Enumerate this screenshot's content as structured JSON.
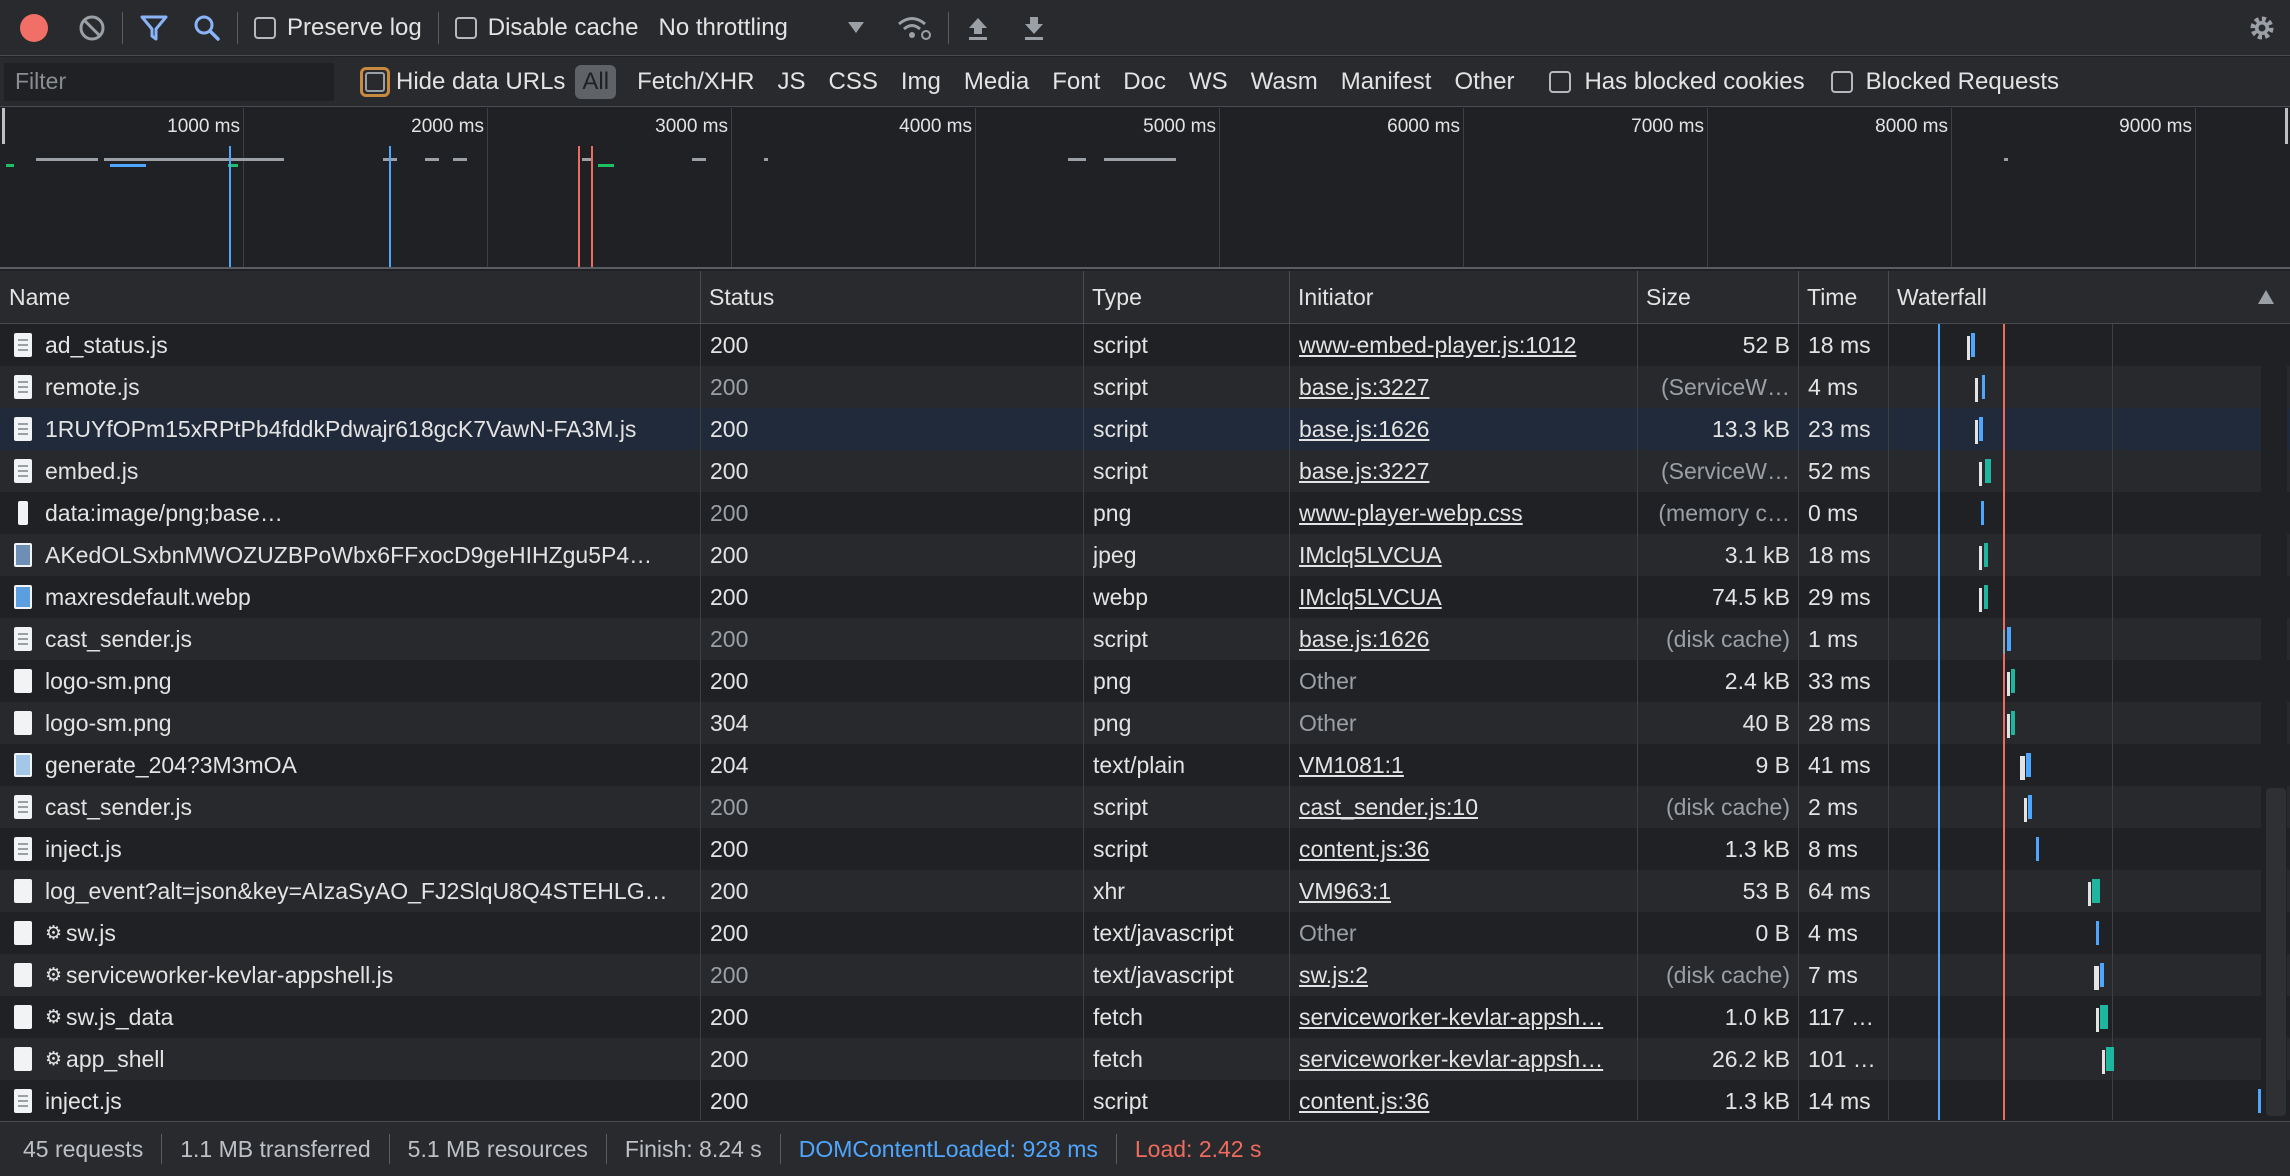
{
  "toolbar": {
    "preserve_log": "Preserve log",
    "disable_cache": "Disable cache",
    "throttling": "No throttling"
  },
  "filterbar": {
    "filter_placeholder": "Filter",
    "hide_data_urls": "Hide data URLs",
    "types": [
      "All",
      "Fetch/XHR",
      "JS",
      "CSS",
      "Img",
      "Media",
      "Font",
      "Doc",
      "WS",
      "Wasm",
      "Manifest",
      "Other"
    ],
    "has_blocked_cookies": "Has blocked cookies",
    "blocked_requests": "Blocked Requests"
  },
  "overview": {
    "ticks": [
      "1000 ms",
      "2000 ms",
      "3000 ms",
      "4000 ms",
      "5000 ms",
      "6000 ms",
      "7000 ms",
      "8000 ms",
      "9000 ms"
    ]
  },
  "table": {
    "columns": [
      "Name",
      "Status",
      "Type",
      "Initiator",
      "Size",
      "Time",
      "Waterfall"
    ],
    "rows": [
      {
        "name": "ad_status.js",
        "status": "200",
        "type": "script",
        "initiator": "www-embed-player.js:1012",
        "size": "52 B",
        "time": "18 ms"
      },
      {
        "name": "remote.js",
        "status": "200",
        "type": "script",
        "initiator": "base.js:3227",
        "size": "(ServiceW…",
        "time": "4 ms"
      },
      {
        "name": "1RUYfOPm15xRPtPb4fddkPdwajr618gcK7VawN-FA3M.js",
        "status": "200",
        "type": "script",
        "initiator": "base.js:1626",
        "size": "13.3 kB",
        "time": "23 ms"
      },
      {
        "name": "embed.js",
        "status": "200",
        "type": "script",
        "initiator": "base.js:3227",
        "size": "(ServiceW…",
        "time": "52 ms"
      },
      {
        "name": "data:image/png;base…",
        "status": "200",
        "type": "png",
        "initiator": "www-player-webp.css",
        "size": "(memory c…",
        "time": "0 ms"
      },
      {
        "name": "AKedOLSxbnMWOZUZBPoWbx6FFxocD9geHIHZgu5P4…",
        "status": "200",
        "type": "jpeg",
        "initiator": "IMclq5LVCUA",
        "size": "3.1 kB",
        "time": "18 ms"
      },
      {
        "name": "maxresdefault.webp",
        "status": "200",
        "type": "webp",
        "initiator": "IMclq5LVCUA",
        "size": "74.5 kB",
        "time": "29 ms"
      },
      {
        "name": "cast_sender.js",
        "status": "200",
        "type": "script",
        "initiator": "base.js:1626",
        "size": "(disk cache)",
        "time": "1 ms"
      },
      {
        "name": "logo-sm.png",
        "status": "200",
        "type": "png",
        "initiator": "Other",
        "size": "2.4 kB",
        "time": "33 ms"
      },
      {
        "name": "logo-sm.png",
        "status": "304",
        "type": "png",
        "initiator": "Other",
        "size": "40 B",
        "time": "28 ms"
      },
      {
        "name": "generate_204?3M3mOA",
        "status": "204",
        "type": "text/plain",
        "initiator": "VM1081:1",
        "size": "9 B",
        "time": "41 ms"
      },
      {
        "name": "cast_sender.js",
        "status": "200",
        "type": "script",
        "initiator": "cast_sender.js:10",
        "size": "(disk cache)",
        "time": "2 ms"
      },
      {
        "name": "inject.js",
        "status": "200",
        "type": "script",
        "initiator": "content.js:36",
        "size": "1.3 kB",
        "time": "8 ms"
      },
      {
        "name": "log_event?alt=json&key=AIzaSyAO_FJ2SlqU8Q4STEHLG…",
        "status": "200",
        "type": "xhr",
        "initiator": "VM963:1",
        "size": "53 B",
        "time": "64 ms"
      },
      {
        "name": "sw.js",
        "status": "200",
        "type": "text/javascript",
        "initiator": "Other",
        "size": "0 B",
        "time": "4 ms"
      },
      {
        "name": "serviceworker-kevlar-appshell.js",
        "status": "200",
        "type": "text/javascript",
        "initiator": "sw.js:2",
        "size": "(disk cache)",
        "time": "7 ms"
      },
      {
        "name": "sw.js_data",
        "status": "200",
        "type": "fetch",
        "initiator": "serviceworker-kevlar-appsh…",
        "size": "1.0 kB",
        "time": "117 …"
      },
      {
        "name": "app_shell",
        "status": "200",
        "type": "fetch",
        "initiator": "serviceworker-kevlar-appsh…",
        "size": "26.2 kB",
        "time": "101 …"
      },
      {
        "name": "inject.js",
        "status": "200",
        "type": "script",
        "initiator": "content.js:36",
        "size": "1.3 kB",
        "time": "14 ms"
      }
    ]
  },
  "statusbar": {
    "requests": "45 requests",
    "transferred": "1.1 MB transferred",
    "resources": "5.1 MB resources",
    "finish": "Finish: 8.24 s",
    "dcl": "DOMContentLoaded: 928 ms",
    "load": "Load: 2.42 s"
  },
  "colors": {
    "dcl_line": "#4fa6ff",
    "load_line": "#ef6b5e",
    "record": "#f16f67",
    "accent_blue": "#8ab4f8"
  },
  "icons": [
    "record-icon",
    "clear-icon",
    "filter-icon",
    "search-icon",
    "wifi-settings-icon",
    "upload-icon",
    "download-icon",
    "gear-icon"
  ]
}
